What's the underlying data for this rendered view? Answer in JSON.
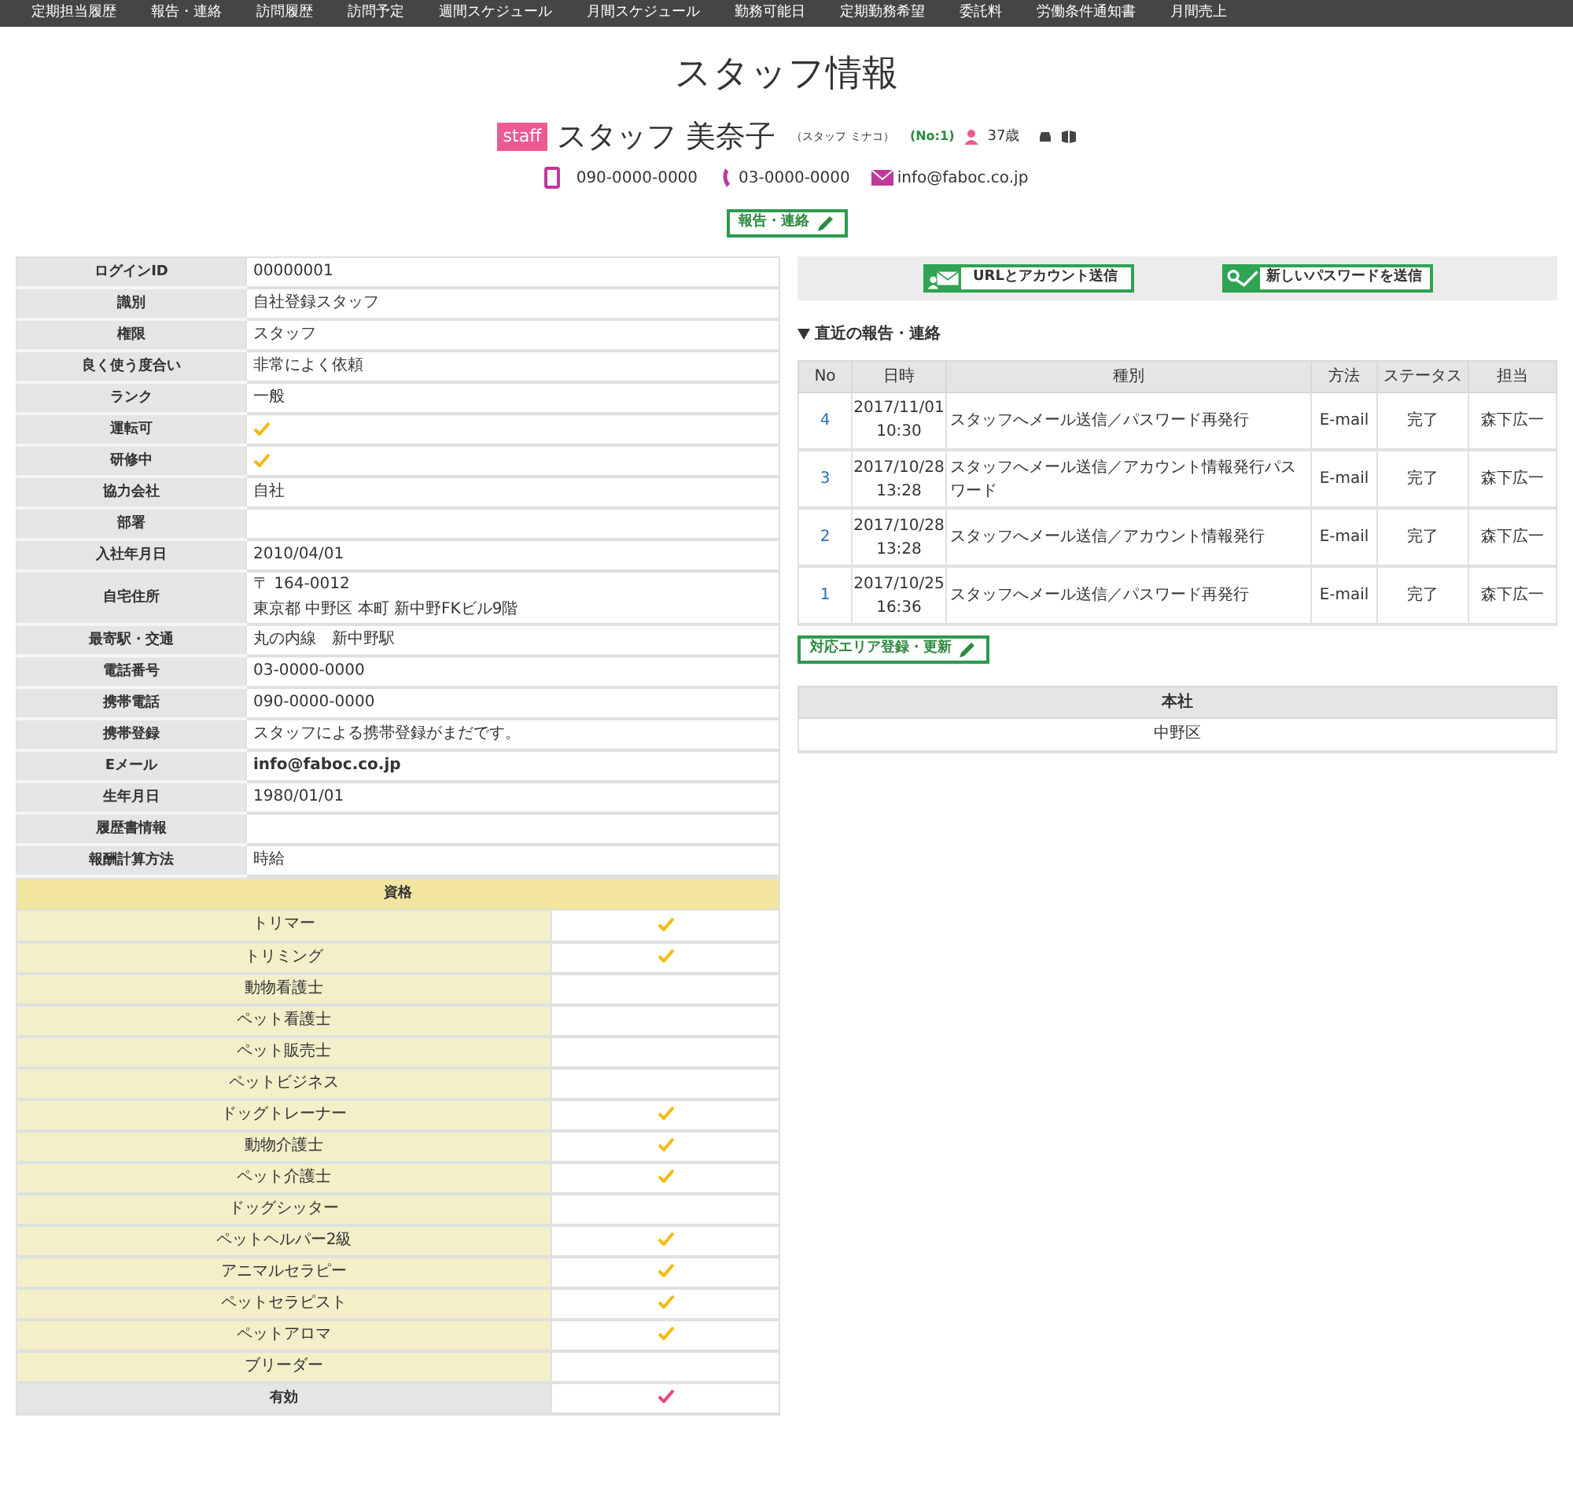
{
  "nav": [
    "定期担当履歴",
    "報告・連絡",
    "訪問履歴",
    "訪問予定",
    "週間スケジュール",
    "月間スケジュール",
    "勤務可能日",
    "定期勤務希望",
    "委託料",
    "労働条件通知書",
    "月間売上"
  ],
  "title": "スタッフ情報",
  "profile": {
    "badge": "staff",
    "name": "スタッフ 美奈子",
    "kana": "（スタッフ ミナコ）",
    "number": "(No:1)",
    "age": "37歳",
    "mobile": "090-0000-0000",
    "phone": "03-0000-0000",
    "email": "info@faboc.co.jp"
  },
  "report_button": "報告・連絡",
  "info": [
    {
      "label": "ログインID",
      "kind": "text",
      "value": "00000001"
    },
    {
      "label": "識別",
      "kind": "text",
      "value": "自社登録スタッフ"
    },
    {
      "label": "権限",
      "kind": "text",
      "value": "スタッフ"
    },
    {
      "label": "良く使う度合い",
      "kind": "text",
      "value": "非常によく依頼"
    },
    {
      "label": "ランク",
      "kind": "text",
      "value": "一般"
    },
    {
      "label": "運転可",
      "kind": "check",
      "checked": true
    },
    {
      "label": "研修中",
      "kind": "check",
      "checked": true
    },
    {
      "label": "協力会社",
      "kind": "text",
      "value": "自社"
    },
    {
      "label": "部署",
      "kind": "text"
    },
    {
      "label": "入社年月日",
      "kind": "text",
      "value": "2010/04/01"
    },
    {
      "label": "自宅住所",
      "kind": "lines",
      "lines": [
        "〒 164-0012",
        "東京都 中野区 本町 新中野FKビル9階"
      ]
    },
    {
      "label": "最寄駅・交通",
      "kind": "text",
      "value": "丸の内線　新中野駅"
    },
    {
      "label": "電話番号",
      "kind": "text",
      "value": "03-0000-0000"
    },
    {
      "label": "携帯電話",
      "kind": "text",
      "value": "090-0000-0000"
    },
    {
      "label": "携帯登録",
      "kind": "text",
      "value": "スタッフによる携帯登録がまだです。"
    },
    {
      "label": "Eメール",
      "kind": "bold",
      "value": "info@faboc.co.jp"
    },
    {
      "label": "生年月日",
      "kind": "text",
      "value": "1980/01/01"
    },
    {
      "label": "履歴書情報",
      "kind": "text"
    },
    {
      "label": "報酬計算方法",
      "kind": "text",
      "value": "時給"
    }
  ],
  "qualifications": {
    "heading": "資格",
    "items": [
      {
        "label": "トリマー",
        "checked": true
      },
      {
        "label": "トリミング",
        "checked": true
      },
      {
        "label": "動物看護士",
        "checked": false
      },
      {
        "label": "ペット看護士",
        "checked": false
      },
      {
        "label": "ペット販売士",
        "checked": false
      },
      {
        "label": "ペットビジネス",
        "checked": false
      },
      {
        "label": "ドッグトレーナー",
        "checked": true
      },
      {
        "label": "動物介護士",
        "checked": true
      },
      {
        "label": "ペット介護士",
        "checked": true
      },
      {
        "label": "ドッグシッター",
        "checked": false
      },
      {
        "label": "ペットヘルパー2級",
        "checked": true
      },
      {
        "label": "アニマルセラピー",
        "checked": true
      },
      {
        "label": "ペットセラピスト",
        "checked": true
      },
      {
        "label": "ペットアロマ",
        "checked": true
      },
      {
        "label": "ブリーダー",
        "checked": false
      }
    ],
    "valid": {
      "label": "有効",
      "checked": true
    }
  },
  "actions": [
    "URLとアカウント送信",
    "新しいパスワードを送信"
  ],
  "recent": {
    "heading": "直近の報告・連絡",
    "expanded": true,
    "columns": [
      "No",
      "日時",
      "種別",
      "方法",
      "ステータス",
      "担当"
    ],
    "rows": [
      {
        "no": "4",
        "date": "2017/11/01",
        "time": "10:30",
        "type": "スタッフへメール送信／パスワード再発行",
        "method": "E-mail",
        "status": "完了",
        "staff": "森下広一"
      },
      {
        "no": "3",
        "date": "2017/10/28",
        "time": "13:28",
        "type": "スタッフへメール送信／アカウント情報発行パスワード",
        "method": "E-mail",
        "status": "完了",
        "staff": "森下広一"
      },
      {
        "no": "2",
        "date": "2017/10/28",
        "time": "13:28",
        "type": "スタッフへメール送信／アカウント情報発行",
        "method": "E-mail",
        "status": "完了",
        "staff": "森下広一"
      },
      {
        "no": "1",
        "date": "2017/10/25",
        "time": "16:36",
        "type": "スタッフへメール送信／パスワード再発行",
        "method": "E-mail",
        "status": "完了",
        "staff": "森下広一"
      }
    ]
  },
  "area_button": "対応エリア登録・更新",
  "area": {
    "heading": "本社",
    "value": "中野区"
  }
}
